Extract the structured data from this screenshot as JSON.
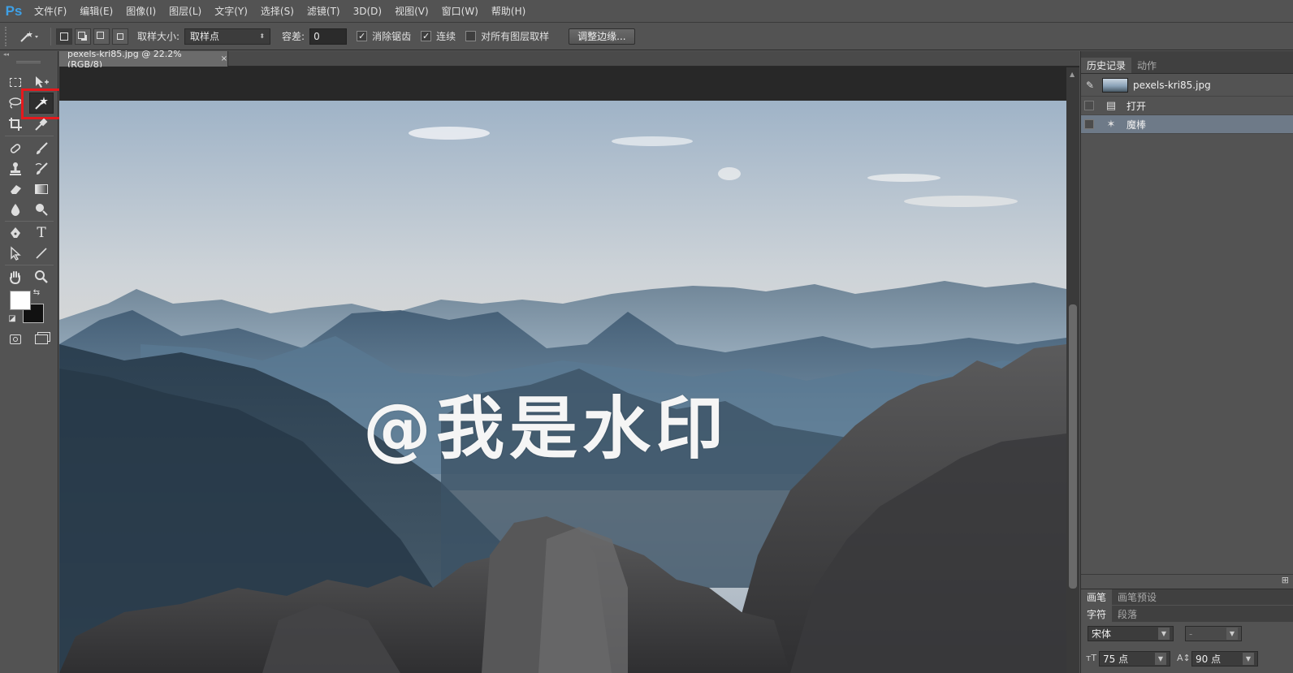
{
  "app": {
    "logo": "Ps",
    "menus": [
      "文件(F)",
      "编辑(E)",
      "图像(I)",
      "图层(L)",
      "文字(Y)",
      "选择(S)",
      "滤镜(T)",
      "3D(D)",
      "视图(V)",
      "窗口(W)",
      "帮助(H)"
    ]
  },
  "options": {
    "sample_size_label": "取样大小:",
    "sample_size_value": "取样点",
    "tolerance_label": "容差:",
    "tolerance_value": "0",
    "anti_alias_label": "消除锯齿",
    "anti_alias_checked": true,
    "contiguous_label": "连续",
    "contiguous_checked": true,
    "sample_all_layers_label": "对所有图层取样",
    "sample_all_layers_checked": false,
    "refine_edge_label": "调整边缘..."
  },
  "document": {
    "tab_title": "pexels-kri85.jpg @ 22.2%(RGB/8)",
    "close_glyph": "×",
    "watermark_text": "@我是水印"
  },
  "toolbox": {
    "collapse_glyph": "◂◂",
    "active_tool": "magic-wand"
  },
  "history_panel": {
    "tabs": [
      "历史记录",
      "动作"
    ],
    "snapshot_name": "pexels-kri85.jpg",
    "states": [
      {
        "label": "打开",
        "icon": "document-icon",
        "active": false
      },
      {
        "label": "魔棒",
        "icon": "magic-wand-icon",
        "active": true
      }
    ]
  },
  "brush_panel": {
    "tabs": [
      "画笔",
      "画笔预设"
    ]
  },
  "character_panel": {
    "tabs": [
      "字符",
      "段落"
    ],
    "font_family": "宋体",
    "font_style": "-",
    "font_size": "75 点",
    "leading": "90 点"
  },
  "colors": {
    "selection_highlight": "#e5191d",
    "ps_logo": "#3ea0e6",
    "active_history_row": "#6e7a88"
  }
}
